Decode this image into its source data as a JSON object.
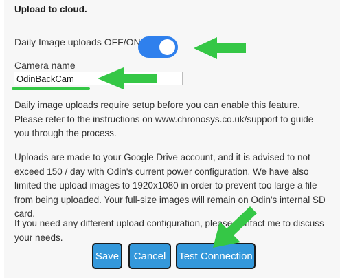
{
  "section": {
    "heading": "Upload to cloud."
  },
  "toggle": {
    "label": "Daily Image uploads OFF/ON",
    "state": "on"
  },
  "camera": {
    "label": "Camera name",
    "value": "OdinBackCam"
  },
  "paragraphs": [
    "Daily image uploads require setup before you can enable this feature. Please refer to the instructions on www.chronosys.co.uk/support to guide you through the process.",
    "Uploads are made to your Google Drive account, and it is advised to not exceed 150 / day with Odin's current power configuration. We have also limited the upload images to 1920x1080 in order to prevent too large a file from being uploaded. Your full-size images will remain on Odin's internal SD card.",
    "If you need any different upload configuration, please contact me to discuss your needs."
  ],
  "buttons": {
    "save": "Save",
    "cancel": "Cancel",
    "test": "Test Connection"
  },
  "colors": {
    "accent": "#2f80ed",
    "button": "#3498db",
    "annotation": "#35c746"
  },
  "annotations": [
    {
      "icon": "arrow-left-icon",
      "points_to": "toggle"
    },
    {
      "icon": "arrow-left-icon",
      "points_to": "camera-name-field"
    },
    {
      "icon": "arrow-down-left-icon",
      "points_to": "test-connection-button"
    }
  ]
}
